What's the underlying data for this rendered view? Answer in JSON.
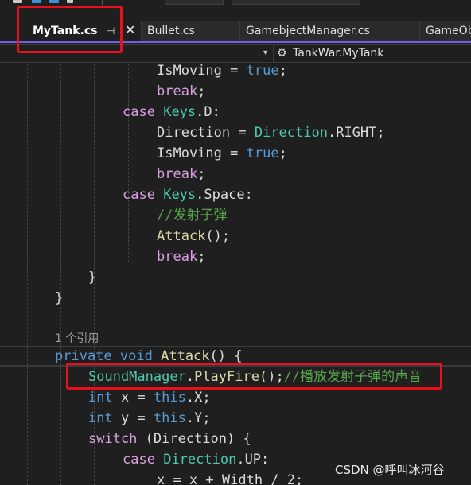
{
  "tabs": [
    {
      "label": "MyTank.cs",
      "active": true,
      "pin": "⊣",
      "close": "✕"
    },
    {
      "label": "Bullet.cs",
      "active": false
    },
    {
      "label": "GamebjectManager.cs",
      "active": false
    },
    {
      "label": "GameOb",
      "active": false
    }
  ],
  "navigation": {
    "left_dropdown_arrow": "▾",
    "class_icon": "⚙",
    "class_selector": "TankWar.MyTank"
  },
  "code": {
    "codelens": "1 个引用",
    "lines": [
      [
        {
          "t": "IsMoving",
          "c": "pl"
        },
        {
          "t": " = ",
          "c": "pl"
        },
        {
          "t": "true",
          "c": "kw"
        },
        {
          "t": ";",
          "c": "pl"
        }
      ],
      [
        {
          "t": "break",
          "c": "ctl"
        },
        {
          "t": ";",
          "c": "pl"
        }
      ],
      [
        {
          "t": "case",
          "c": "ctl"
        },
        {
          "t": " ",
          "c": "pl"
        },
        {
          "t": "Keys",
          "c": "typ"
        },
        {
          "t": ".D:",
          "c": "pl"
        }
      ],
      [
        {
          "t": "Direction",
          "c": "pl"
        },
        {
          "t": " = ",
          "c": "pl"
        },
        {
          "t": "Direction",
          "c": "typ"
        },
        {
          "t": ".RIGHT;",
          "c": "pl"
        }
      ],
      [
        {
          "t": "IsMoving",
          "c": "pl"
        },
        {
          "t": " = ",
          "c": "pl"
        },
        {
          "t": "true",
          "c": "kw"
        },
        {
          "t": ";",
          "c": "pl"
        }
      ],
      [
        {
          "t": "break",
          "c": "ctl"
        },
        {
          "t": ";",
          "c": "pl"
        }
      ],
      [
        {
          "t": "case",
          "c": "ctl"
        },
        {
          "t": " ",
          "c": "pl"
        },
        {
          "t": "Keys",
          "c": "typ"
        },
        {
          "t": ".Space:",
          "c": "pl"
        }
      ],
      [
        {
          "t": "//发射子弹",
          "c": "cmt"
        }
      ],
      [
        {
          "t": "Attack",
          "c": "mth"
        },
        {
          "t": "();",
          "c": "pl"
        }
      ],
      [
        {
          "t": "break",
          "c": "ctl"
        },
        {
          "t": ";",
          "c": "pl"
        }
      ],
      [
        {
          "t": "}",
          "c": "pl"
        }
      ],
      [
        {
          "t": "}",
          "c": "pl"
        }
      ],
      [],
      [
        {
          "t": "private",
          "c": "kw"
        },
        {
          "t": " ",
          "c": "pl"
        },
        {
          "t": "void",
          "c": "kw"
        },
        {
          "t": " ",
          "c": "pl"
        },
        {
          "t": "Attack",
          "c": "mth"
        },
        {
          "t": "() {",
          "c": "pl"
        }
      ],
      [
        {
          "t": "SoundManager",
          "c": "typ"
        },
        {
          "t": ".",
          "c": "pl"
        },
        {
          "t": "PlayFire",
          "c": "mth"
        },
        {
          "t": "();",
          "c": "pl"
        },
        {
          "t": "//播放发射子弹的声音",
          "c": "cmt"
        }
      ],
      [
        {
          "t": "int",
          "c": "kw"
        },
        {
          "t": " x = ",
          "c": "pl"
        },
        {
          "t": "this",
          "c": "kw"
        },
        {
          "t": ".X;",
          "c": "pl"
        }
      ],
      [
        {
          "t": "int",
          "c": "kw"
        },
        {
          "t": " y = ",
          "c": "pl"
        },
        {
          "t": "this",
          "c": "kw"
        },
        {
          "t": ".Y;",
          "c": "pl"
        }
      ],
      [
        {
          "t": "switch",
          "c": "ctl"
        },
        {
          "t": " (Direction) {",
          "c": "pl"
        }
      ],
      [
        {
          "t": "case",
          "c": "ctl"
        },
        {
          "t": " ",
          "c": "pl"
        },
        {
          "t": "Direction",
          "c": "typ"
        },
        {
          "t": ".UP:",
          "c": "pl"
        }
      ],
      [
        {
          "t": "x = x + Width / 2;",
          "c": "pl"
        }
      ]
    ]
  },
  "watermark": "CSDN @呼叫冰河谷",
  "colors": {
    "accent_tab_underline": "#7160e8",
    "annotation_red": "#e8101c",
    "keyword": "#569cd6",
    "control": "#d8a0df",
    "type": "#4ec9b0",
    "method": "#dcdcaa",
    "comment": "#57a64a"
  }
}
